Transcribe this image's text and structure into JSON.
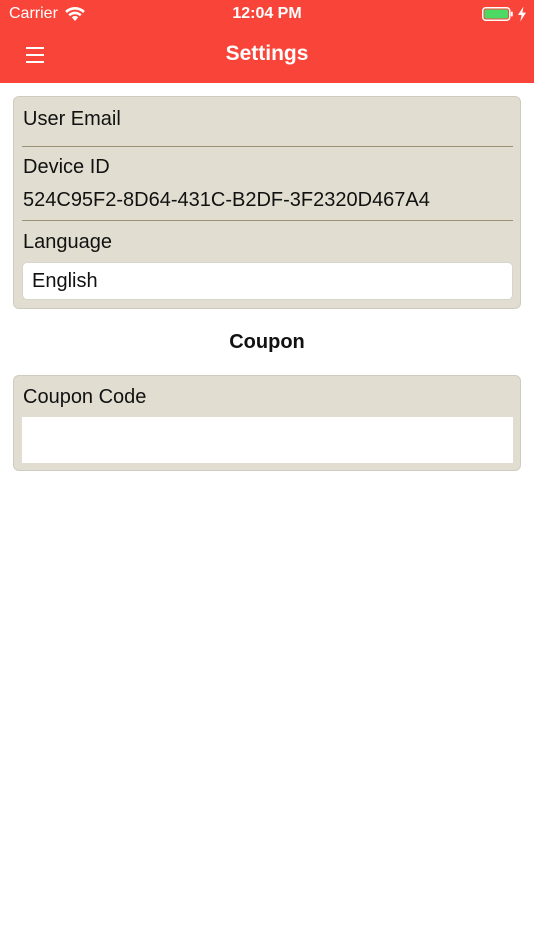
{
  "status_bar": {
    "carrier": "Carrier",
    "time": "12:04 PM",
    "wifi_icon": "wifi-icon",
    "battery_icon": "battery-icon",
    "charging_icon": "charging-bolt-icon",
    "battery_level": 1.0
  },
  "nav": {
    "title": "Settings",
    "menu_icon": "hamburger-menu-icon",
    "bar_color": "#f94539"
  },
  "info_card": {
    "user_email_label": "User Email",
    "user_email_value": "",
    "device_id_label": "Device ID",
    "device_id_value": "524C95F2-8D64-431C-B2DF-3F2320D467A4",
    "language_label": "Language",
    "language_value": "English"
  },
  "coupon_section": {
    "title": "Coupon",
    "coupon_code_label": "Coupon Code",
    "coupon_code_value": "",
    "coupon_code_placeholder": ""
  },
  "colors": {
    "card_background": "#e1ded1",
    "divider": "#9a9078",
    "accent": "#f94539",
    "battery_fill": "#4cd964"
  }
}
